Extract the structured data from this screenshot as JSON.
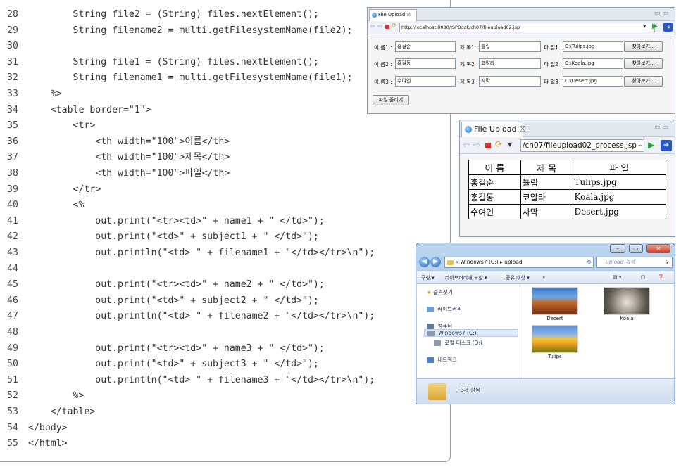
{
  "code": {
    "lines": [
      {
        "num": "28",
        "text": "        String file2 = (String) files.nextElement();"
      },
      {
        "num": "29",
        "text": "        String filename2 = multi.getFilesystemName(file2);"
      },
      {
        "num": "30",
        "text": ""
      },
      {
        "num": "31",
        "text": "        String file1 = (String) files.nextElement();"
      },
      {
        "num": "32",
        "text": "        String filename1 = multi.getFilesystemName(file1);"
      },
      {
        "num": "33",
        "text": "    %>"
      },
      {
        "num": "34",
        "text": "    <table border=\"1\">"
      },
      {
        "num": "35",
        "text": "        <tr>"
      },
      {
        "num": "36",
        "text": "            <th width=\"100\">이름</th>"
      },
      {
        "num": "37",
        "text": "            <th width=\"100\">제목</th>"
      },
      {
        "num": "38",
        "text": "            <th width=\"100\">파일</th>"
      },
      {
        "num": "39",
        "text": "        </tr>"
      },
      {
        "num": "40",
        "text": "        <%"
      },
      {
        "num": "41",
        "text": "            out.print(\"<tr><td>\" + name1 + \" </td>\");"
      },
      {
        "num": "42",
        "text": "            out.print(\"<td>\" + subject1 + \" </td>\");"
      },
      {
        "num": "43",
        "text": "            out.println(\"<td> \" + filename1 + \"</td></tr>\\n\");"
      },
      {
        "num": "44",
        "text": ""
      },
      {
        "num": "45",
        "text": "            out.print(\"<tr><td>\" + name2 + \" </td>\");"
      },
      {
        "num": "46",
        "text": "            out.print(\"<td>\" + subject2 + \" </td>\");"
      },
      {
        "num": "47",
        "text": "            out.println(\"<td> \" + filename2 + \"</td></tr>\\n\");"
      },
      {
        "num": "48",
        "text": ""
      },
      {
        "num": "49",
        "text": "            out.print(\"<tr><td>\" + name3 + \" </td>\");"
      },
      {
        "num": "50",
        "text": "            out.print(\"<td>\" + subject3 + \" </td>\");"
      },
      {
        "num": "51",
        "text": "            out.println(\"<td> \" + filename3 + \"</td></tr>\\n\");"
      },
      {
        "num": "52",
        "text": "        %>"
      },
      {
        "num": "53",
        "text": "    </table>"
      },
      {
        "num": "54",
        "text": "</body>"
      },
      {
        "num": "55",
        "text": "</html>"
      }
    ]
  },
  "upload_window": {
    "tab_title": "File Upload",
    "tab_close": "☒",
    "url": "http://localhost:8080/JSPBook/ch07/fileupload02.jsp",
    "rows": [
      {
        "name_label": "이 름1 :",
        "name_value": "홍길순",
        "subject_label": "제 목1 :",
        "subject_value": "튤립",
        "file_label": "파 일1 :",
        "file_value": "C:\\Tulips.jpg",
        "browse": "찾아보기..."
      },
      {
        "name_label": "이 름2 :",
        "name_value": "홍길동",
        "subject_label": "제 목2 :",
        "subject_value": "코알라",
        "file_label": "파 일2 :",
        "file_value": "C:\\Koala.jpg",
        "browse": "찾아보기..."
      },
      {
        "name_label": "이 름3 :",
        "name_value": "수여인",
        "subject_label": "제 목3 :",
        "subject_value": "사막",
        "file_label": "파 일3 :",
        "file_value": "C:\\Desert.jpg",
        "browse": "찾아보기..."
      }
    ],
    "submit_label": "파일 올리기"
  },
  "result_window": {
    "tab_title": "File Upload",
    "tab_close": "☒",
    "url": "/ch07/fileupload02_process.jsp",
    "headers": [
      "이 름",
      "제 목",
      "파 일"
    ],
    "rows": [
      [
        "홍길순",
        "튤립",
        "Tulips.jpg"
      ],
      [
        "홍길동",
        "코알라",
        "Koala.jpg"
      ],
      [
        "수여인",
        "사막",
        "Desert.jpg"
      ]
    ]
  },
  "explorer": {
    "address": "« Windows7 (C:) ▸ upload",
    "search_placeholder": "upload 검색",
    "toolbar": {
      "organize": "구성 ▾",
      "include_library": "라이브러리에 포함 ▾",
      "share": "공유 대상 ▾",
      "more": "»"
    },
    "nav": {
      "favorites": "즐겨찾기",
      "libraries": "라이브러리",
      "computer": "컴퓨터",
      "drive_c": "Windows7 (C:)",
      "drive_d": "로컬 디스크 (D:)",
      "network": "네트워크"
    },
    "files": [
      {
        "name": "Desert",
        "icon": "desert-thumbnail"
      },
      {
        "name": "Koala",
        "icon": "koala-thumbnail"
      },
      {
        "name": "Tulips",
        "icon": "tulips-thumbnail"
      }
    ],
    "status": "3개 항목"
  },
  "colors": {
    "accent": "#2a56c8",
    "stop": "#d9342b"
  }
}
